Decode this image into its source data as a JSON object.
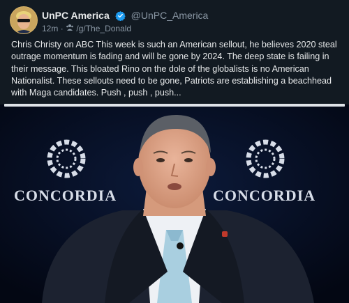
{
  "account": {
    "display_name": "UnPC America",
    "handle": "@UnPC_America",
    "verified_icon": "verified-badge-icon",
    "timestamp": "12m",
    "separator": "·",
    "community": "/g/The_Donald"
  },
  "post": {
    "text": "Chris Christy on ABC This week is such an American sellout, he believes 2020 steal outrage momentum is fading and will be gone by 2024. The deep state is failing in their message. This bloated Rino on the dole of the globalists is no American Nationalist. These sellouts need to be gone, Patriots are establishing a beachhead with Maga candidates. Push , push , push..."
  },
  "media": {
    "logo_left": "CONCORDIA",
    "logo_right": "CONCORDIA"
  },
  "colors": {
    "background": "#121a22",
    "text": "#e7e9ea",
    "muted": "#8b98a5",
    "verified": "#1d9bf0"
  }
}
